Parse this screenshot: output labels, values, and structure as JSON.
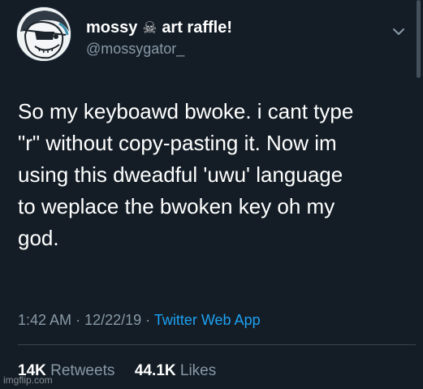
{
  "tweet": {
    "display_name": "mossy",
    "name_emoji": "☠",
    "name_suffix": "art raffle!",
    "handle": "@mossygator_",
    "text_lines": [
      "So my keyboawd bwoke. i cant type",
      "\"r\" without copy-pasting it. Now im",
      "using this dweadful 'uwu' language",
      "to weplace the bwoken key oh my",
      "god."
    ],
    "time": "1:42 AM",
    "date": "12/22/19",
    "separator": "·",
    "source": "Twitter Web App",
    "retweets_count": "14K",
    "retweets_label": "Retweets",
    "likes_count": "44.1K",
    "likes_label": "Likes"
  },
  "watermark": "imgflip.com",
  "icons": {
    "menu": "chevron-down-icon",
    "avatar": "cartoon-avatar"
  },
  "colors": {
    "background": "#141d26",
    "text": "#ffffff",
    "secondary_text": "#8899a6",
    "link": "#1da1f2",
    "divider": "#38444d"
  }
}
